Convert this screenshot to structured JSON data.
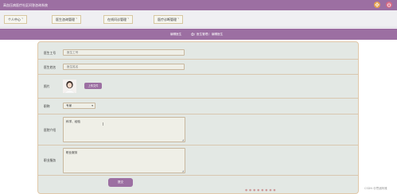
{
  "header": {
    "app_title": "高血压病医疗社区问答咨询系统",
    "gear_icon": "gear-icon",
    "power_icon": "power-icon"
  },
  "nav": {
    "items": [
      {
        "label": "个人中心 ˅"
      },
      {
        "label": "医生咨询管理 ˅"
      },
      {
        "label": "在线问诊管理 ˅"
      },
      {
        "label": "医疗诊断管理 ˅"
      }
    ]
  },
  "breadcrumb": {
    "page_title": "编辑医生",
    "home_icon": "home-icon",
    "sep1": "/",
    "level1": "医生管理",
    "sep2": "/",
    "level2": "编辑医生"
  },
  "form": {
    "doctor_no": {
      "label": "医生工号",
      "placeholder": "医生工号"
    },
    "doctor_name": {
      "label": "医生姓名",
      "placeholder": "医生姓名"
    },
    "photo": {
      "label": "照片",
      "upload_label": "上传文件"
    },
    "title": {
      "label": "职称",
      "selected": "专家"
    },
    "intro": {
      "label": "医院介绍",
      "value": "科学、经验"
    },
    "service": {
      "label": "职业服务",
      "placeholder": "职业服务"
    },
    "submit_label": "提交"
  },
  "footer": {
    "dots": "●●●●●●●●",
    "watermark": "CSDN @思绪阿雅"
  },
  "colors": {
    "accent": "#9c6fa2",
    "card_bg": "#e3e8e4",
    "card_border": "#e1c8a8"
  }
}
